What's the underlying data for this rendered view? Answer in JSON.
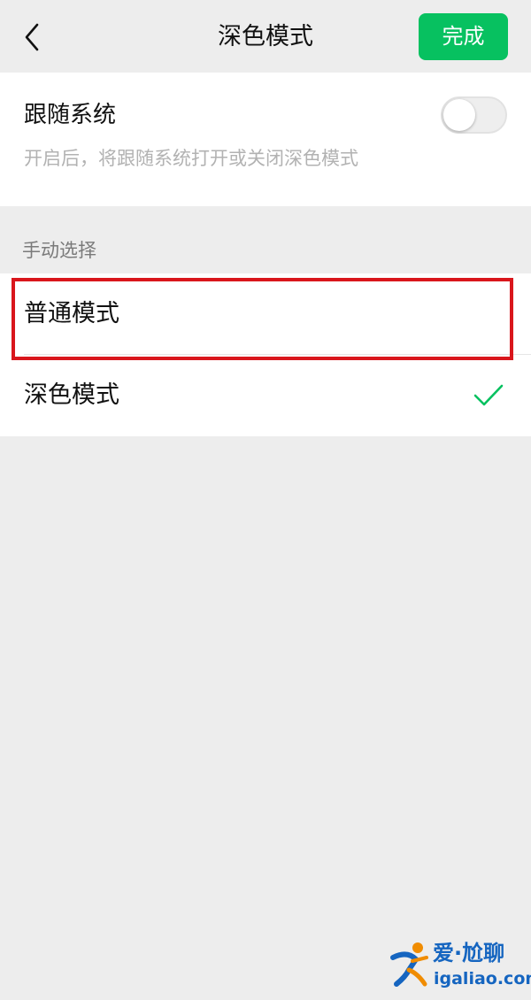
{
  "colors": {
    "accent_green": "#07c160",
    "done_text": "#ffffff",
    "highlight_red": "#d9161c",
    "watermark_blue": "#1565c0",
    "watermark_orange": "#f08c00"
  },
  "nav": {
    "back_icon": "chevron-left-icon",
    "title": "深色模式",
    "done_label": "完成"
  },
  "follow_system": {
    "title": "跟随系统",
    "description": "开启后，将跟随系统打开或关闭深色模式",
    "toggle_on": false
  },
  "manual": {
    "section_label": "手动选择",
    "options": [
      {
        "label": "普通模式",
        "selected": false
      },
      {
        "label": "深色模式",
        "selected": true
      }
    ]
  },
  "watermark": {
    "title": "爱·尬聊",
    "url": "igaliao.com"
  }
}
